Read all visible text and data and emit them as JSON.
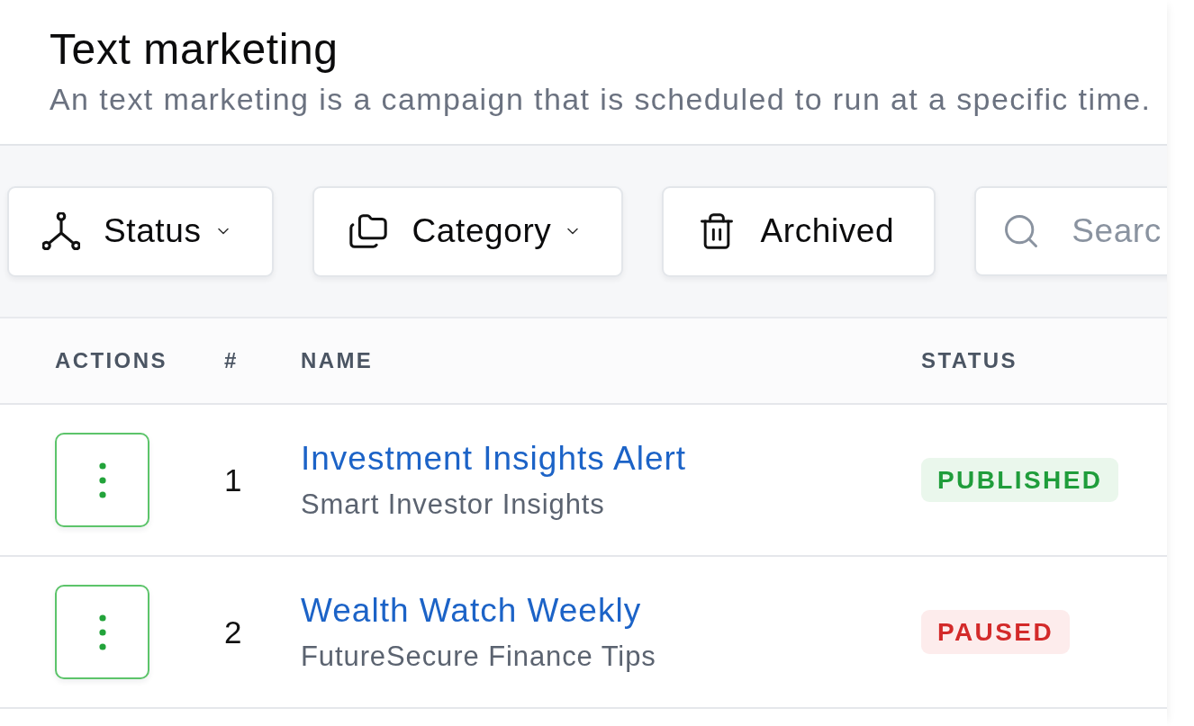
{
  "page": {
    "title": "Text marketing",
    "description": "An text marketing is a campaign that is scheduled to run at a specific time."
  },
  "toolbar": {
    "filters": [
      {
        "label": "Status",
        "kind": "status"
      },
      {
        "label": "Category",
        "kind": "category"
      },
      {
        "label": "Archived",
        "kind": "archived"
      }
    ],
    "search": {
      "placeholder": "Searc"
    }
  },
  "table": {
    "columns": [
      "ACTIONS",
      "#",
      "NAME",
      "STATUS"
    ],
    "rows": [
      {
        "number": "1",
        "name": "Investment Insights Alert",
        "sender": "Smart Investor Insights",
        "status": {
          "label": "PUBLISHED",
          "kind": "published"
        }
      },
      {
        "number": "2",
        "name": "Wealth Watch Weekly",
        "sender": "FutureSecure Finance Tips",
        "status": {
          "label": "PAUSED",
          "kind": "paused"
        }
      }
    ]
  }
}
